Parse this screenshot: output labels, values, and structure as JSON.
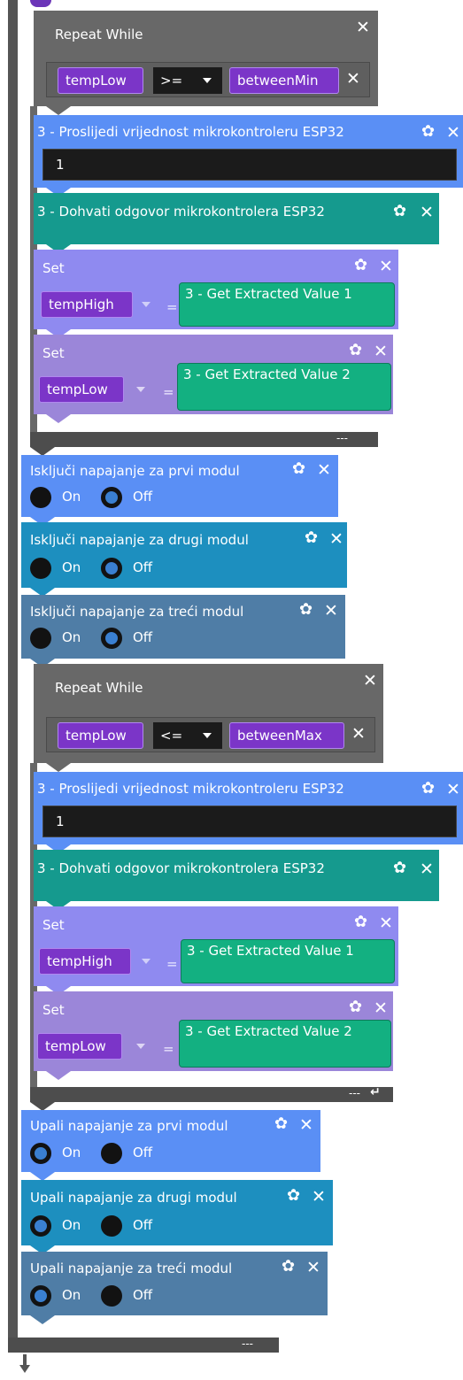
{
  "colors": {
    "spine": "#555555",
    "repeat_bg": "#686868",
    "repeat_inner": "#5f5f5f",
    "blue": "#5a8ff5",
    "teal": "#159a8e",
    "set1": "#8f8af0",
    "set2": "#9b86d9",
    "modul_blue": "#5a8ff5",
    "modul_cyan": "#1d8fbf",
    "modul_steel": "#4f7da6",
    "variable": "#7b35c8",
    "extracted": "#13b081"
  },
  "loop1": {
    "title": "Repeat While",
    "left_var": "tempLow",
    "operator": ">=",
    "right_var": "betweenMin",
    "send": {
      "label": "Proslijedi vrijednost mikrokontroleru ESP32",
      "value": "1"
    },
    "receive": {
      "label": "Dohvati odgovor mikrokontrolera ESP32"
    },
    "set1": {
      "label": "Set",
      "var": "tempHigh",
      "equals": "=",
      "value": "3 - Get Extracted Value 1"
    },
    "set2": {
      "label": "Set",
      "var": "tempLow",
      "equals": "=",
      "value": "3 - Get Extracted Value 2"
    },
    "footer": "---"
  },
  "prefix": "3 -",
  "power_off": [
    {
      "label": "Isključi napajanje za prvi modul",
      "on": "On",
      "off": "Off",
      "state": "off"
    },
    {
      "label": "Isključi napajanje za drugi modul",
      "on": "On",
      "off": "Off",
      "state": "off"
    },
    {
      "label": "Isključi napajanje za treći modul",
      "on": "On",
      "off": "Off",
      "state": "off"
    }
  ],
  "loop2": {
    "title": "Repeat While",
    "left_var": "tempLow",
    "operator": "<=",
    "right_var": "betweenMax",
    "send": {
      "label": "Proslijedi vrijednost mikrokontroleru ESP32",
      "value": "1"
    },
    "receive": {
      "label": "Dohvati odgovor mikrokontrolera ESP32"
    },
    "set1": {
      "label": "Set",
      "var": "tempHigh",
      "equals": "=",
      "value": "3 - Get Extracted Value 1"
    },
    "set2": {
      "label": "Set",
      "var": "tempLow",
      "equals": "=",
      "value": "3 - Get Extracted Value 2"
    },
    "footer": "---"
  },
  "power_on": [
    {
      "label": "Upali napajanje za prvi modul",
      "on": "On",
      "off": "Off",
      "state": "on"
    },
    {
      "label": "Upali napajanje za drugi modul",
      "on": "On",
      "off": "Off",
      "state": "on"
    },
    {
      "label": "Upali napajanje za treći modul",
      "on": "On",
      "off": "Off",
      "state": "on"
    }
  ],
  "outer_footer": "---",
  "icons": {
    "close": "close-icon",
    "gear": "gear-icon",
    "dropdown": "chevron-down-icon",
    "return": "return-icon",
    "arrow": "arrow-down-icon"
  }
}
